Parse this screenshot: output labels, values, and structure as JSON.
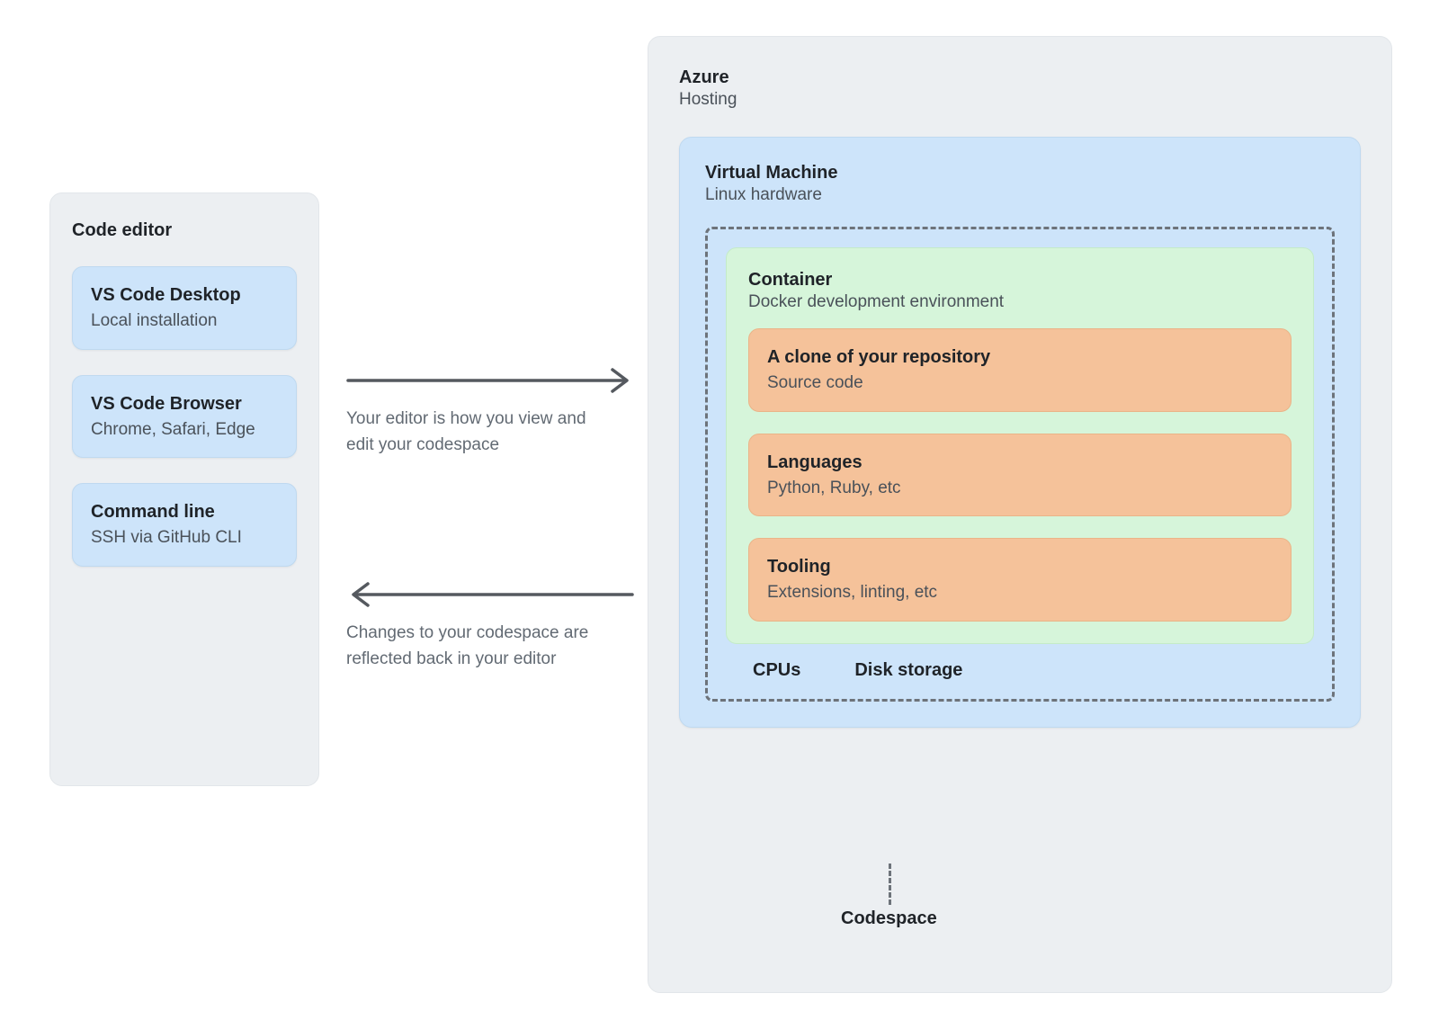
{
  "editor": {
    "title": "Code editor",
    "cards": [
      {
        "title": "VS Code Desktop",
        "sub": "Local installation"
      },
      {
        "title": "VS Code Browser",
        "sub": "Chrome, Safari, Edge"
      },
      {
        "title": "Command line",
        "sub": "SSH via GitHub CLI"
      }
    ]
  },
  "arrows": {
    "forward_caption": "Your editor is how you view and edit your codespace",
    "back_caption": "Changes to your codespace are reflected back in your editor"
  },
  "azure": {
    "title": "Azure",
    "sub": "Hosting",
    "vm": {
      "title": "Virtual Machine",
      "sub": "Linux hardware",
      "codespace_label": "Codespace",
      "container": {
        "title": "Container",
        "sub": "Docker development environment",
        "items": [
          {
            "title": "A clone of your repository",
            "sub": "Source code"
          },
          {
            "title": "Languages",
            "sub": "Python, Ruby, etc"
          },
          {
            "title": "Tooling",
            "sub": "Extensions, linting, etc"
          }
        ]
      },
      "hw": {
        "cpus": "CPUs",
        "disk": "Disk storage"
      }
    }
  }
}
